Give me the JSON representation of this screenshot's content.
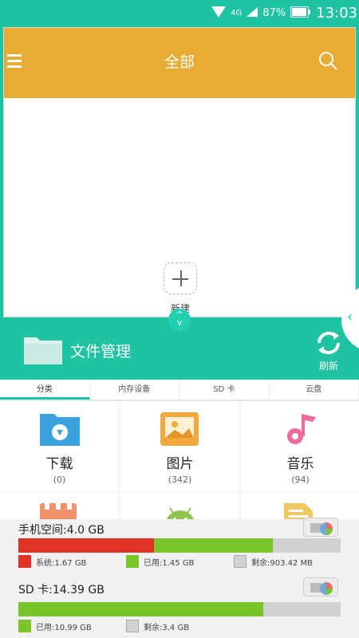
{
  "status_bar": {
    "network": "4G",
    "battery": "87%",
    "time": "13:03"
  },
  "card": {
    "title": "全部",
    "new_label": "新建"
  },
  "toggle": {
    "up": "^",
    "down": "v"
  },
  "file_manager": {
    "title": "文件管理",
    "refresh_label": "刷新"
  },
  "tabs": [
    {
      "label": "分类",
      "active": true
    },
    {
      "label": "内存设备",
      "active": false
    },
    {
      "label": "SD 卡",
      "active": false
    },
    {
      "label": "云盘",
      "active": false
    }
  ],
  "categories": [
    {
      "label": "下载",
      "count": "(0)",
      "icon": "download-folder-icon",
      "color": "#3aa3df"
    },
    {
      "label": "图片",
      "count": "(342)",
      "icon": "image-icon",
      "color": "#f4a73a"
    },
    {
      "label": "音乐",
      "count": "(94)",
      "icon": "music-note-icon",
      "color": "#f06b9b"
    }
  ],
  "storage": {
    "phone": {
      "title": "手机空间:4.0 GB",
      "system": "系统:1.67 GB",
      "used": "已用:1.45 GB",
      "free": "剩余:903.42 MB",
      "system_frac": 0.42,
      "used_frac": 0.37
    },
    "sd": {
      "title": "SD 卡:14.39 GB",
      "used": "已用:10.99 GB",
      "free": "剩余:3.4 GB",
      "used_frac": 0.76
    }
  },
  "colors": {
    "accent": "#1fc3a1",
    "header": "#e8ac35",
    "system": "#e03225",
    "used": "#7ac52a",
    "free": "#d1d1d1"
  }
}
